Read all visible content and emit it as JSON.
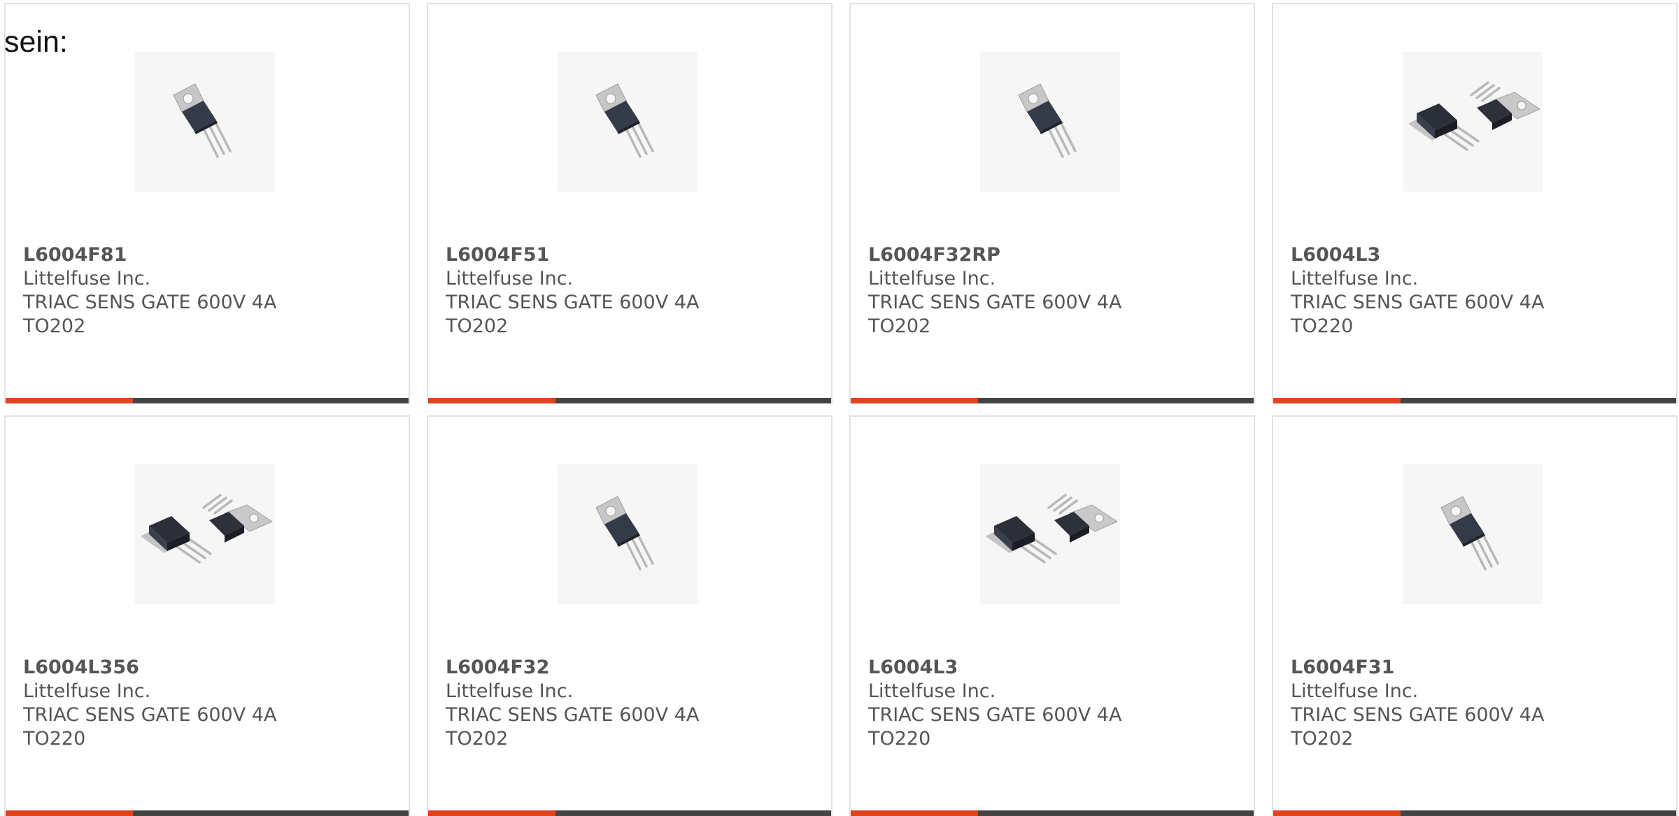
{
  "intro_text": "sein:",
  "accent_color": "#e2431d",
  "bar_color": "#444444",
  "products": [
    {
      "part_number": "L6004F81",
      "manufacturer": "Littelfuse Inc.",
      "description": "TRIAC SENS GATE 600V 4A",
      "package": "TO202",
      "icon": "to202-transistor-icon"
    },
    {
      "part_number": "L6004F51",
      "manufacturer": "Littelfuse Inc.",
      "description": "TRIAC SENS GATE 600V 4A",
      "package": "TO202",
      "icon": "to202-transistor-icon"
    },
    {
      "part_number": "L6004F32RP",
      "manufacturer": "Littelfuse Inc.",
      "description": "TRIAC SENS GATE 600V 4A",
      "package": "TO202",
      "icon": "to202-transistor-icon"
    },
    {
      "part_number": "L6004L3",
      "manufacturer": "Littelfuse Inc.",
      "description": "TRIAC SENS GATE 600V 4A",
      "package": "TO220",
      "icon": "to220-pair-icon"
    },
    {
      "part_number": "L6004L356",
      "manufacturer": "Littelfuse Inc.",
      "description": "TRIAC SENS GATE 600V 4A",
      "package": "TO220",
      "icon": "to220-pair-icon"
    },
    {
      "part_number": "L6004F32",
      "manufacturer": "Littelfuse Inc.",
      "description": "TRIAC SENS GATE 600V 4A",
      "package": "TO202",
      "icon": "to202-transistor-icon"
    },
    {
      "part_number": "L6004L3",
      "manufacturer": "Littelfuse Inc.",
      "description": "TRIAC SENS GATE 600V 4A",
      "package": "TO220",
      "icon": "to220-pair-icon"
    },
    {
      "part_number": "L6004F31",
      "manufacturer": "Littelfuse Inc.",
      "description": "TRIAC SENS GATE 600V 4A",
      "package": "TO202",
      "icon": "to202-transistor-icon"
    }
  ]
}
